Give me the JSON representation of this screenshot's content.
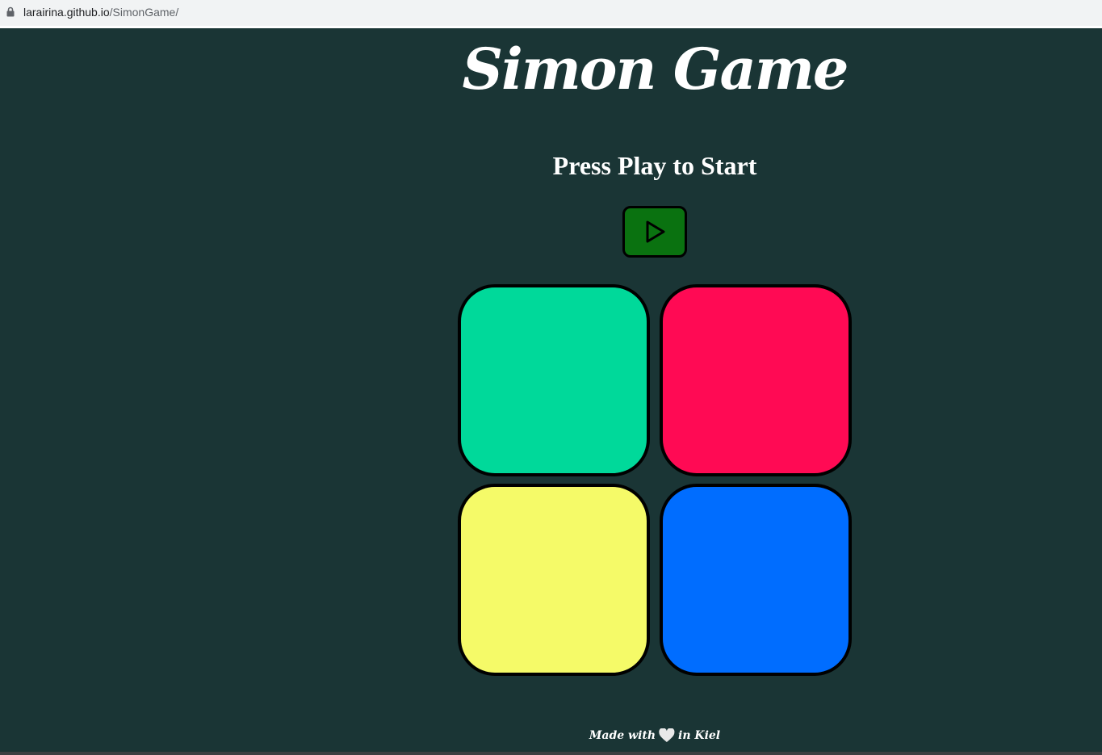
{
  "browser": {
    "url_host": "larairina.github.io",
    "url_path": "/SimonGame/"
  },
  "game": {
    "title": "Simon Game",
    "status": "Press Play to Start",
    "play_icon": "play-icon",
    "pads": [
      {
        "color": "#00d99a"
      },
      {
        "color": "#ff0a54"
      },
      {
        "color": "#f5fa68"
      },
      {
        "color": "#006dff"
      }
    ]
  },
  "footer": {
    "prefix": "Made with",
    "icon": "heart-icon",
    "suffix": "in Kiel"
  }
}
